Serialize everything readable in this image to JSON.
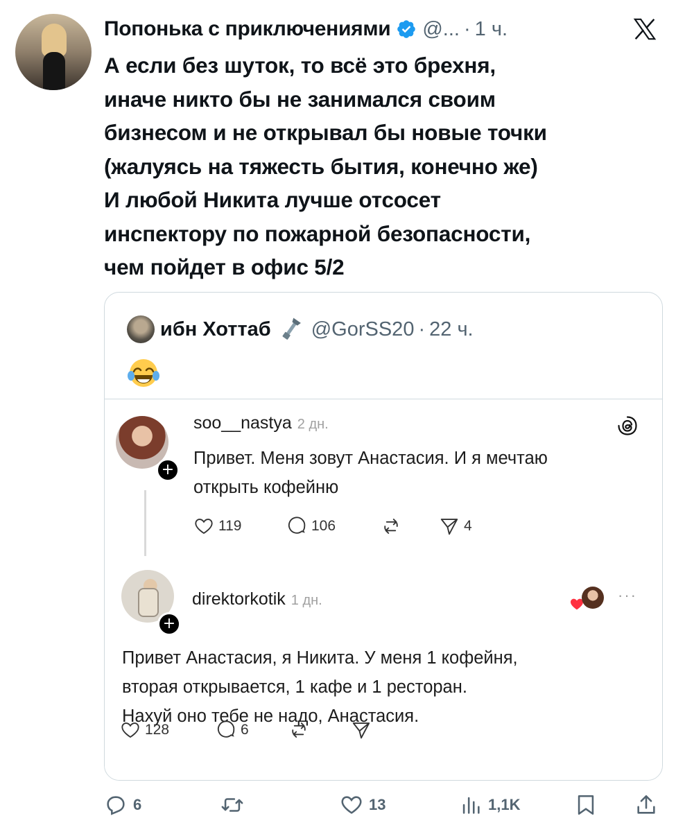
{
  "tweet": {
    "author_name": "Попонька с приключениями",
    "verified": true,
    "handle": "@...",
    "separator": "·",
    "time": "1 ч.",
    "text": "А если без шуток, то всё это брехня,\nиначе никто бы не занимался своим\nбизнесом и не открывал бы новые точки\n(жалуясь на тяжесть бытия, конечно  же)\nИ любой Никита лучше отсосет\nинспектору по пожарной безопасности,\nчем пойдет в офис 5/2"
  },
  "quote": {
    "author_name": "ибн Хоттаб",
    "handle": "@GorSS20",
    "separator": "·",
    "time": "22 ч.",
    "emoji": "😂",
    "threads": {
      "post1": {
        "username": "soo__nastya",
        "ago": "2 дн.",
        "text": "Привет. Меня зовут Анастасия. И я мечтаю\nоткрыть кофейню",
        "likes": "119",
        "comments": "106",
        "shares": "4"
      },
      "post2": {
        "username": "direktorkotik",
        "ago": "1 дн.",
        "text": "Привет Анастасия, я Никита. У меня 1 кофейня,\nвторая открывается, 1 кафе и 1 ресторан.\nНахуй оно тебе не надо, Анастасия.",
        "likes": "128",
        "comments": "6"
      }
    }
  },
  "actions": {
    "replies": "6",
    "likes": "13",
    "views": "1,1K"
  },
  "icons": [
    "verified-icon",
    "x-logo-icon",
    "wrench-icon",
    "threads-logo-icon",
    "heart-icon",
    "comment-icon",
    "repost-icon",
    "send-icon",
    "reply-icon",
    "retweet-icon",
    "views-icon",
    "bookmark-icon",
    "share-icon"
  ],
  "colors": {
    "verified": "#1d9bf0",
    "secondary_text": "#536471",
    "border": "#cfd9de"
  }
}
